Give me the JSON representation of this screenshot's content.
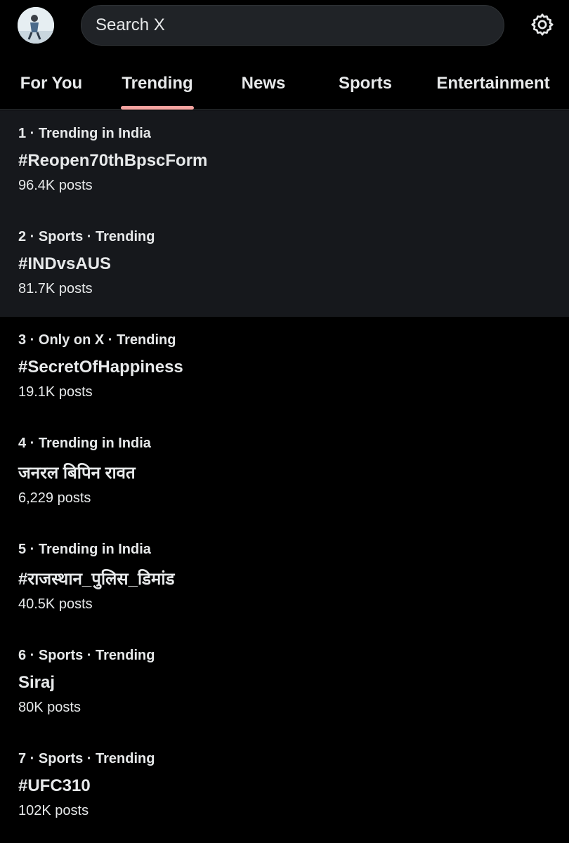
{
  "header": {
    "search_placeholder": "Search X",
    "avatar_icon": "profile-avatar",
    "settings_icon": "gear-icon"
  },
  "tabs": [
    {
      "label": "For You",
      "active": false
    },
    {
      "label": "Trending",
      "active": true
    },
    {
      "label": "News",
      "active": false
    },
    {
      "label": "Sports",
      "active": false
    },
    {
      "label": "Entertainment",
      "active": false
    }
  ],
  "trends": [
    {
      "meta": "1 · Trending in India",
      "title": "#Reopen70thBpscForm",
      "count": "96.4K posts"
    },
    {
      "meta": "2 · Sports · Trending",
      "title": "#INDvsAUS",
      "count": "81.7K posts"
    },
    {
      "meta": "3 · Only on X · Trending",
      "title": "#SecretOfHappiness",
      "count": "19.1K posts"
    },
    {
      "meta": "4 · Trending in India",
      "title": "जनरल बिपिन रावत",
      "count": "6,229 posts"
    },
    {
      "meta": "5 · Trending in India",
      "title": "#राजस्थान_पुलिस_डिमांड",
      "count": "40.5K posts"
    },
    {
      "meta": "6 · Sports · Trending",
      "title": "Siraj",
      "count": "80K posts"
    },
    {
      "meta": "7 · Sports · Trending",
      "title": "#UFC310",
      "count": "102K posts"
    }
  ],
  "colors": {
    "background": "#000000",
    "highlight_row": "#16181c",
    "active_tab_indicator": "#f4a3a0",
    "search_bg": "#202327"
  }
}
